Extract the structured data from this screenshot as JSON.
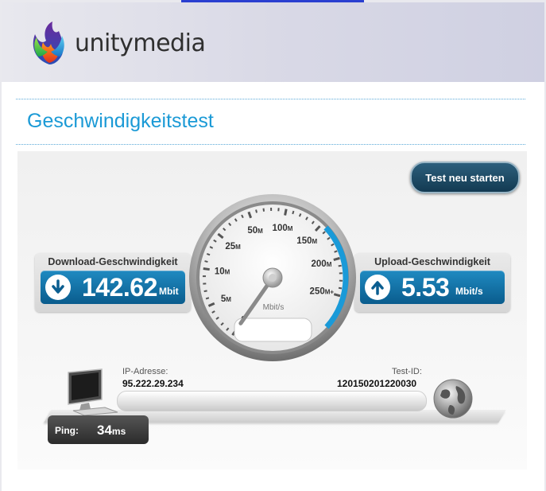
{
  "header": {
    "brand_name": "unitymedia",
    "logo_icon": "unitymedia-flame-logo-icon"
  },
  "page": {
    "title": "Geschwindigkeitstest"
  },
  "actions": {
    "restart_label": "Test neu starten"
  },
  "download": {
    "label": "Download-Geschwindigkeit",
    "value": "142.62",
    "unit": "Mbit",
    "icon": "arrow-down-icon"
  },
  "upload": {
    "label": "Upload-Geschwindigkeit",
    "value": "5.53",
    "unit": "Mbit/s",
    "icon": "arrow-up-icon"
  },
  "gauge": {
    "unit_label": "Mbit/s",
    "ticks": [
      {
        "num": "0",
        "suffix": ""
      },
      {
        "num": "5",
        "suffix": "M"
      },
      {
        "num": "10",
        "suffix": "M"
      },
      {
        "num": "25",
        "suffix": "M"
      },
      {
        "num": "50",
        "suffix": "M"
      },
      {
        "num": "100",
        "suffix": "M"
      },
      {
        "num": "150",
        "suffix": "M"
      },
      {
        "num": "200",
        "suffix": "M"
      },
      {
        "num": "250",
        "suffix": "M+"
      }
    ],
    "needle_value": 0
  },
  "network": {
    "ip_label": "IP-Adresse:",
    "ip_value": "95.222.29.234",
    "test_id_label": "Test-ID:",
    "test_id_value": "120150201220030"
  },
  "ping": {
    "label": "Ping:",
    "value": "34",
    "unit": "ms"
  },
  "colors": {
    "accent": "#1b9ad6",
    "value_box": "#0a5c8d",
    "button": "#133a52"
  }
}
